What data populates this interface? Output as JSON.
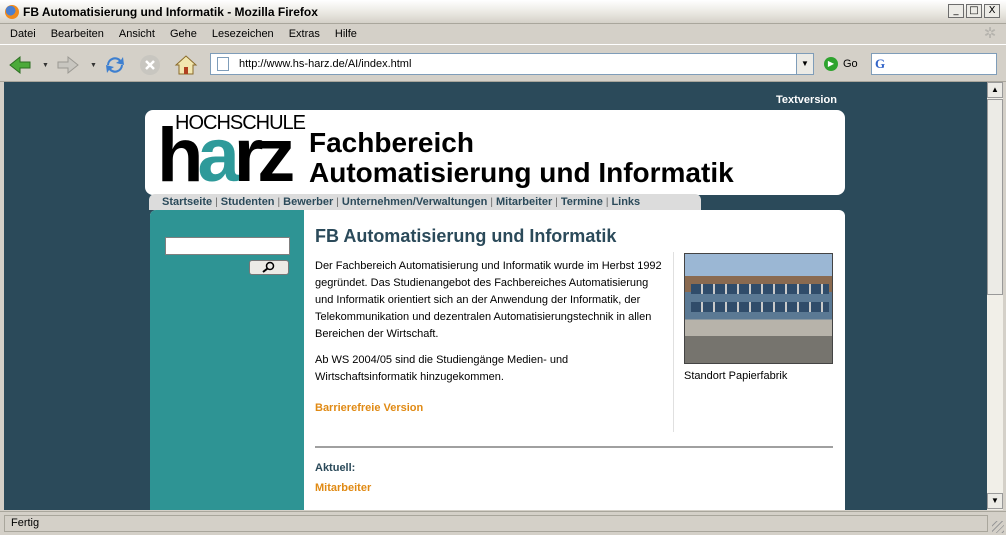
{
  "window": {
    "title": "FB Automatisierung und Informatik - Mozilla Firefox",
    "btn_min": "_",
    "btn_max": "□",
    "btn_close": "X"
  },
  "menu": [
    "Datei",
    "Bearbeiten",
    "Ansicht",
    "Gehe",
    "Lesezeichen",
    "Extras",
    "Hilfe"
  ],
  "toolbar": {
    "url": "http://www.hs-harz.de/AI/index.html",
    "go_label": "Go"
  },
  "page": {
    "textversion": "Textversion",
    "logo": {
      "top": "HOCHSCHULE",
      "h": "h",
      "a": "a",
      "rz": "rz"
    },
    "header_line1": "Fachbereich",
    "header_line2": "Automatisierung und Informatik",
    "nav": [
      "Startseite",
      "Studenten",
      "Bewerber",
      "Unternehmen/Verwaltungen",
      "Mitarbeiter",
      "Termine",
      "Links"
    ],
    "title": "FB Automatisierung und Informatik",
    "intro": "Der Fachbereich Automatisierung und Informatik wurde im Herbst 1992 gegründet. Das Studienangebot des Fachbereiches Automatisierung und Informatik orientiert sich an der Anwendung der Informatik, der Telekommunikation und dezentralen Automatisierungstechnik in allen Bereichen der Wirtschaft.",
    "intro2": "Ab WS 2004/05 sind die Studiengänge Medien- und Wirtschaftsinformatik hinzugekommen.",
    "barrierefrei": "Barrierefreie Version",
    "photo_caption": "Standort Papierfabrik",
    "aktuell": "Aktuell:",
    "mitarbeiter": "Mitarbeiter"
  },
  "status": "Fertig",
  "colors": {
    "bg": "#2b4a5a",
    "teal": "#2e9494",
    "orange": "#e08a14"
  }
}
